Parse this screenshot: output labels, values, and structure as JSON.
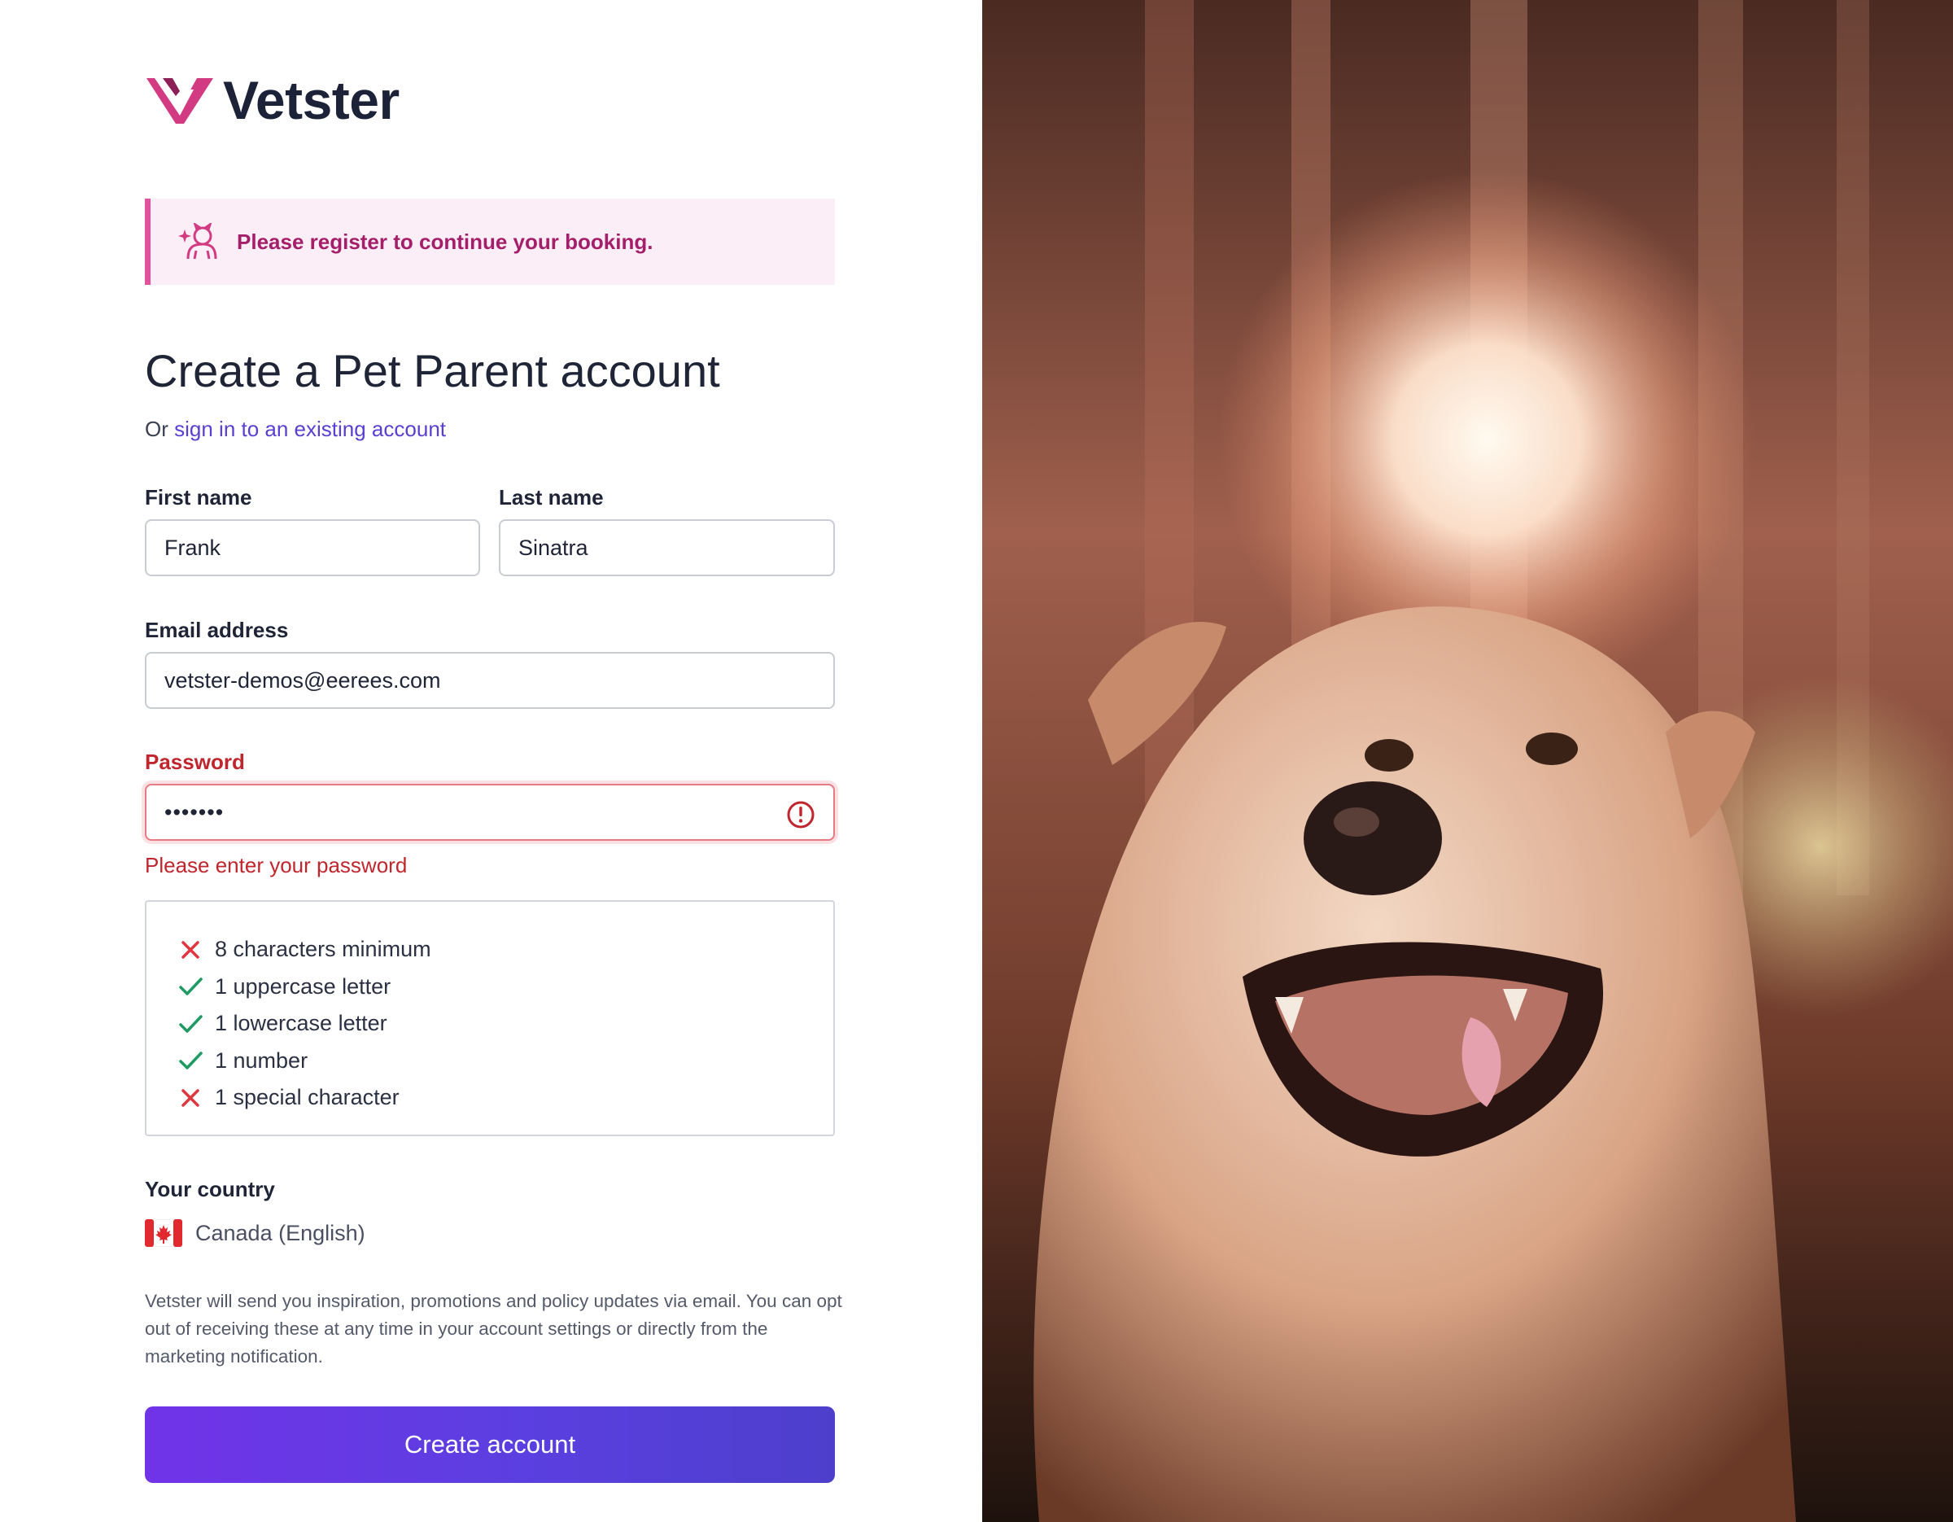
{
  "brand": {
    "name": "Vetster",
    "logo_icon": "vetster-v-logo-icon",
    "primary_color": "#5b3fe0",
    "accent_pink": "#e2529c"
  },
  "alert": {
    "icon": "pet-icon",
    "text": "Please register to continue your booking."
  },
  "heading": "Create a Pet Parent account",
  "signin": {
    "prefix": "Or",
    "link_text": "sign in to an existing account"
  },
  "fields": {
    "first_name": {
      "label": "First name",
      "value": "Frank"
    },
    "last_name": {
      "label": "Last name",
      "value": "Sinatra"
    },
    "email": {
      "label": "Email address",
      "value": "vetster-demos@eerees.com"
    },
    "password": {
      "label": "Password",
      "value": "•••••••",
      "error": "Please enter your password",
      "error_color": "#c0262d"
    }
  },
  "password_rules": [
    {
      "text": "8 characters minimum",
      "met": false
    },
    {
      "text": "1 uppercase letter",
      "met": true
    },
    {
      "text": "1 lowercase letter",
      "met": true
    },
    {
      "text": "1 number",
      "met": true
    },
    {
      "text": "1 special character",
      "met": false
    }
  ],
  "country": {
    "label": "Your country",
    "value": "Canada (English)",
    "flag": "canada-flag-icon"
  },
  "legal_text": "Vetster will send you inspiration, promotions and policy updates via email. You can opt out of receiving these at any time in your account settings or directly from the marketing notification.",
  "submit_label": "Create account",
  "photo": {
    "subject": "golden-retriever-photo"
  }
}
